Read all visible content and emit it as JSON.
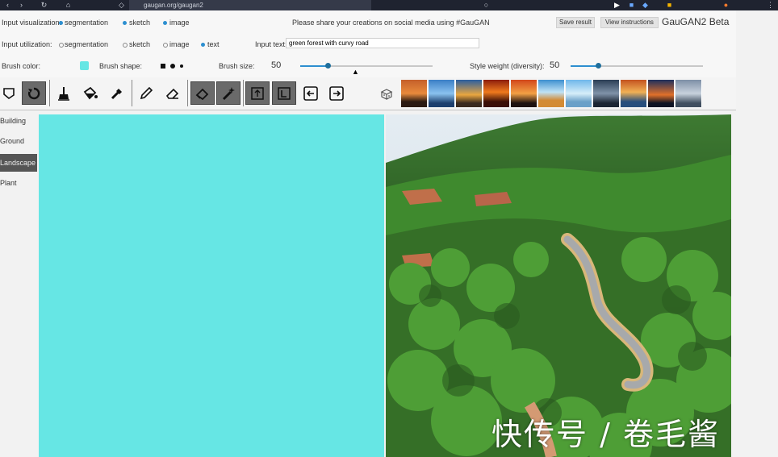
{
  "browser": {
    "tab_title": "gaugan.org/gaugan2",
    "icons": [
      "back-icon",
      "forward-icon",
      "reload-icon",
      "home-icon",
      "shield-icon",
      "lock-icon"
    ]
  },
  "controls_row1": {
    "input_visualization_label": "Input visualization:",
    "options": [
      {
        "label": "segmentation",
        "selected": true
      },
      {
        "label": "sketch",
        "selected": true
      },
      {
        "label": "image",
        "selected": true
      }
    ],
    "share_text": "Please share your creations on social media using #GauGAN",
    "buttons": [
      "Save result",
      "View instructions"
    ],
    "app_title": "GauGAN2 Beta"
  },
  "controls_row2": {
    "input_utilization_label": "Input utilization:",
    "options": [
      {
        "label": "segmentation",
        "selected": false
      },
      {
        "label": "sketch",
        "selected": false
      },
      {
        "label": "image",
        "selected": false
      },
      {
        "label": "text",
        "selected": true
      }
    ],
    "text_input_label": "Input text:",
    "text_input_value": "green forest with curvy road"
  },
  "controls_row3": {
    "brush_color_label": "Brush color:",
    "brush_color": "#66e6e4",
    "brush_shape_label": "Brush shape:",
    "brush_size_label": "Brush size:",
    "brush_size_value": "50",
    "brush_size_fraction": 0.21,
    "style_weight_label": "Style weight (diversity):",
    "style_weight_value": "50",
    "style_weight_fraction": 0.21
  },
  "toolbar": {
    "tools": [
      {
        "name": "select-tool",
        "icon": "lasso-icon",
        "active": false
      },
      {
        "name": "undo-tool",
        "icon": "rotate-icon",
        "active": true
      },
      {
        "name": "brush-tool",
        "icon": "brush-icon",
        "active": false
      },
      {
        "name": "fill-tool",
        "icon": "paint-bucket-icon",
        "active": false
      },
      {
        "name": "pick-tool",
        "icon": "eyedropper-icon",
        "active": false
      },
      {
        "name": "pencil-tool",
        "icon": "pencil-icon",
        "active": false
      },
      {
        "name": "eraser-tool",
        "icon": "eraser-icon",
        "active": false
      },
      {
        "name": "seg-eraser-tool",
        "icon": "eraser-icon",
        "active": true
      },
      {
        "name": "magic-tool",
        "icon": "magic-wand-icon",
        "active": true
      },
      {
        "name": "upload-seg-tool",
        "icon": "upload-icon",
        "active": true
      },
      {
        "name": "download-seg-tool",
        "icon": "download-icon",
        "active": true
      },
      {
        "name": "copy-left-tool",
        "icon": "arrow-left-icon",
        "active": false
      },
      {
        "name": "copy-right-tool",
        "icon": "arrow-right-icon",
        "active": false
      }
    ],
    "dice_icon": "dice-icon"
  },
  "sidebar": {
    "items": [
      {
        "label": "Building",
        "selected": false
      },
      {
        "label": "Ground",
        "selected": false
      },
      {
        "label": "Landscape",
        "selected": true
      },
      {
        "label": "Plant",
        "selected": false
      }
    ]
  },
  "watermark": "快传号 / 卷毛酱"
}
